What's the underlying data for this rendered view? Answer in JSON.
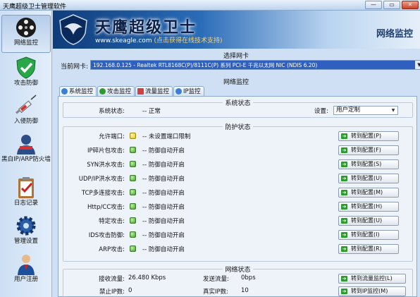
{
  "window": {
    "title": "天鹰超级卫士管理软件",
    "buttons": [
      "—",
      "▭",
      "✕"
    ]
  },
  "sidebar": {
    "items": [
      {
        "label": "网络监控",
        "icon": "film-reel-icon",
        "active": true
      },
      {
        "label": "攻击防御",
        "icon": "shield-check-icon",
        "active": false
      },
      {
        "label": "入侵防御",
        "icon": "syringe-icon",
        "active": false
      },
      {
        "label": "黑白IP/ARP防火墙",
        "icon": "user-avatar-icon",
        "active": false
      },
      {
        "label": "日志记录",
        "icon": "clipboard-check-icon",
        "active": false
      },
      {
        "label": "管理设置",
        "icon": "gear-icon",
        "active": false
      },
      {
        "label": "用户注册",
        "icon": "person-icon",
        "active": false
      }
    ]
  },
  "banner": {
    "brand": "天鹰超级卫士",
    "url": "www.skeagle.com",
    "url_tip": "(点击获得在线技术支持)",
    "section": "网络监控"
  },
  "nic": {
    "group_title": "选择网卡",
    "label": "当前网卡:",
    "value": "192.168.0.125 - Realtek RTL8168C(P)/8111C(P) 系列 PCI-E 千兆以太网 NIC (NDIS 6.20)"
  },
  "monitor_title": "网络监控",
  "tabs": [
    {
      "label": "系统监控",
      "icon_color": "#3a7fd4",
      "active": true
    },
    {
      "label": "攻击监控",
      "icon_color": "#2f9b2f",
      "active": false
    },
    {
      "label": "流量监控",
      "icon_color": "#d04040",
      "active": false
    },
    {
      "label": "IP监控",
      "icon_color": "#3a7fd4",
      "active": false
    }
  ],
  "system_status": {
    "legend": "系统状态",
    "label": "系统状态:",
    "value": "-- 正常",
    "setting_label": "设置:",
    "setting_value": "用户定制"
  },
  "protection": {
    "legend": "防护状态",
    "rows": [
      {
        "label": "允许端口:",
        "status": "-- 未设置端口限制",
        "color": "yellow",
        "button": "转到配置(P)"
      },
      {
        "label": "IP碎片包攻击:",
        "status": "-- 防御自动开启",
        "color": "green",
        "button": "转到配置(F)"
      },
      {
        "label": "SYN洪水攻击:",
        "status": "-- 防御自动开启",
        "color": "green",
        "button": "转到配置(S)"
      },
      {
        "label": "UDP/IP洪水攻击:",
        "status": "-- 防御自动开启",
        "color": "green",
        "button": "转到配置(U)"
      },
      {
        "label": "TCP多连接攻击:",
        "status": "-- 防御自动开启",
        "color": "green",
        "button": "转到配置(M)"
      },
      {
        "label": "Http/CC攻击:",
        "status": "-- 防御自动开启",
        "color": "green",
        "button": "转到配置(H)"
      },
      {
        "label": "特定攻击:",
        "status": "-- 防御自动开启",
        "color": "green",
        "button": "转到配置(U)"
      },
      {
        "label": "IDS攻击防御:",
        "status": "-- 防御自动开启",
        "color": "green",
        "button": "转到配置(I)"
      },
      {
        "label": "ARP攻击:",
        "status": "-- 防御自动开启",
        "color": "green",
        "button": "转到配置(R)"
      }
    ]
  },
  "network_status": {
    "legend": "网络状态",
    "recv_label": "接收流量:",
    "recv_value": "26.480 Kbps",
    "send_label": "发送流量:",
    "send_value": "0bps",
    "traffic_button": "转到流量监控(L)",
    "banned_label": "禁止IP数:",
    "banned_value": "0",
    "real_label": "真实IP数:",
    "real_value": "10",
    "ip_button": "转到IP监控(M)"
  }
}
